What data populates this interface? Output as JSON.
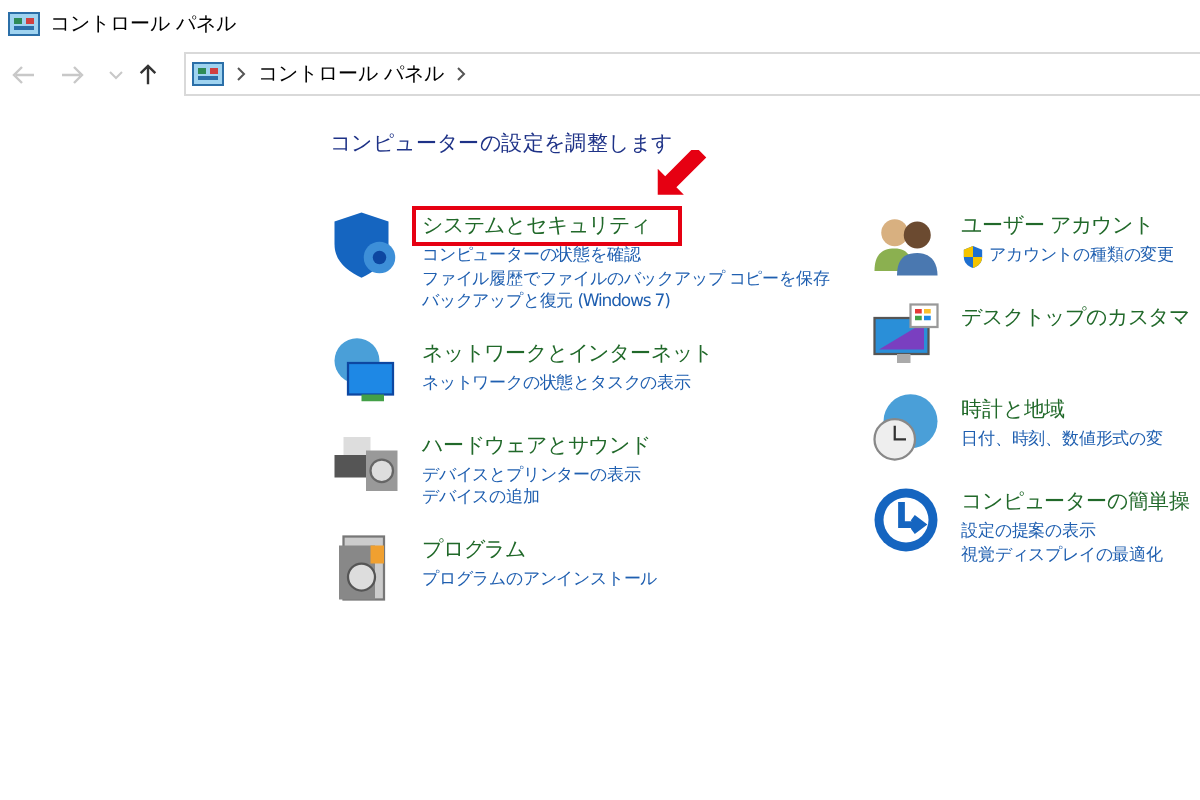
{
  "window": {
    "title": "コントロール パネル"
  },
  "address_bar": {
    "path": [
      "コントロール パネル"
    ]
  },
  "heading": "コンピューターの設定を調整します",
  "left_categories": [
    {
      "kind": "shield",
      "title": "システムとセキュリティ",
      "highlighted": true,
      "links": [
        {
          "text": "コンピューターの状態を確認",
          "shield": false
        },
        {
          "text": "ファイル履歴でファイルのバックアップ コピーを保存",
          "shield": false
        },
        {
          "text": "バックアップと復元 (Windows 7)",
          "shield": false
        }
      ]
    },
    {
      "kind": "network",
      "title": "ネットワークとインターネット",
      "highlighted": false,
      "links": [
        {
          "text": "ネットワークの状態とタスクの表示",
          "shield": false
        }
      ]
    },
    {
      "kind": "printer",
      "title": "ハードウェアとサウンド",
      "highlighted": false,
      "links": [
        {
          "text": "デバイスとプリンターの表示",
          "shield": false
        },
        {
          "text": "デバイスの追加",
          "shield": false
        }
      ]
    },
    {
      "kind": "program",
      "title": "プログラム",
      "highlighted": false,
      "links": [
        {
          "text": "プログラムのアンインストール",
          "shield": false
        }
      ]
    }
  ],
  "right_categories": [
    {
      "kind": "users",
      "title": "ユーザー アカウント",
      "highlighted": false,
      "links": [
        {
          "text": "アカウントの種類の変更",
          "shield": true
        }
      ]
    },
    {
      "kind": "desktop",
      "title": "デスクトップのカスタマ",
      "highlighted": false
    },
    {
      "kind": "clock",
      "title": "時計と地域",
      "highlighted": false,
      "links": [
        {
          "text": "日付、時刻、数値形式の変",
          "shield": false
        }
      ]
    },
    {
      "kind": "access",
      "title": "コンピューターの簡単操",
      "highlighted": false,
      "links": [
        {
          "text": "設定の提案の表示",
          "shield": false
        },
        {
          "text": "視覚ディスプレイの最適化",
          "shield": false
        }
      ]
    }
  ]
}
